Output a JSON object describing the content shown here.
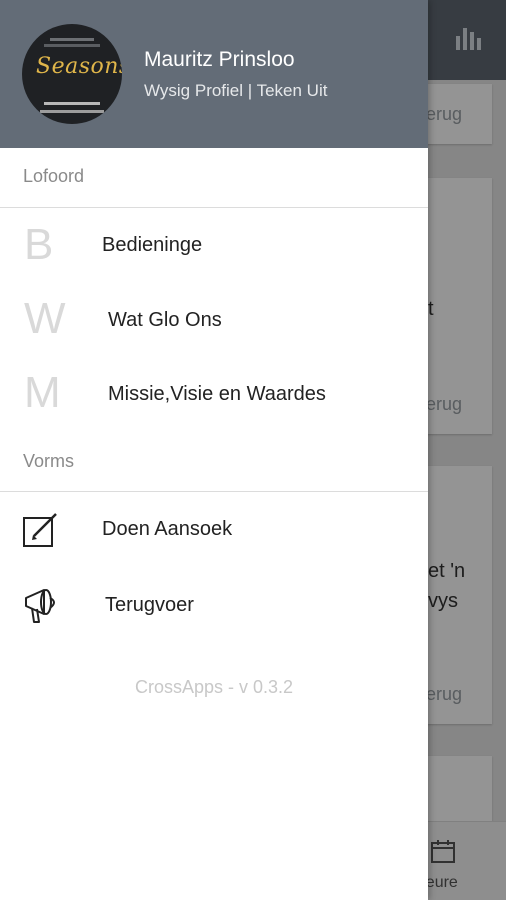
{
  "background": {
    "card_texts": [
      "erug",
      "t",
      "erug",
      "et 'n",
      "vys",
      "erug"
    ],
    "bottom_tab_label": "ebeure"
  },
  "drawer": {
    "user": {
      "name": "Mauritz Prinsloo",
      "links": "Wysig Profiel | Teken Uit",
      "avatar_text": "Seasons"
    },
    "sections": [
      {
        "label": "Lofoord",
        "items": [
          {
            "letter": "B",
            "label": "Bedieninge"
          },
          {
            "letter": "W",
            "label": "Wat Glo Ons"
          },
          {
            "letter": "M",
            "label": "Missie,Visie en Waardes"
          }
        ]
      },
      {
        "label": "Vorms",
        "items": [
          {
            "icon": "edit-form-icon",
            "label": "Doen Aansoek"
          },
          {
            "icon": "megaphone-icon",
            "label": "Terugvoer"
          }
        ]
      }
    ],
    "version": "CrossApps - v 0.3.2"
  },
  "colors": {
    "header": "#636c77",
    "accent_text": "#222222"
  }
}
